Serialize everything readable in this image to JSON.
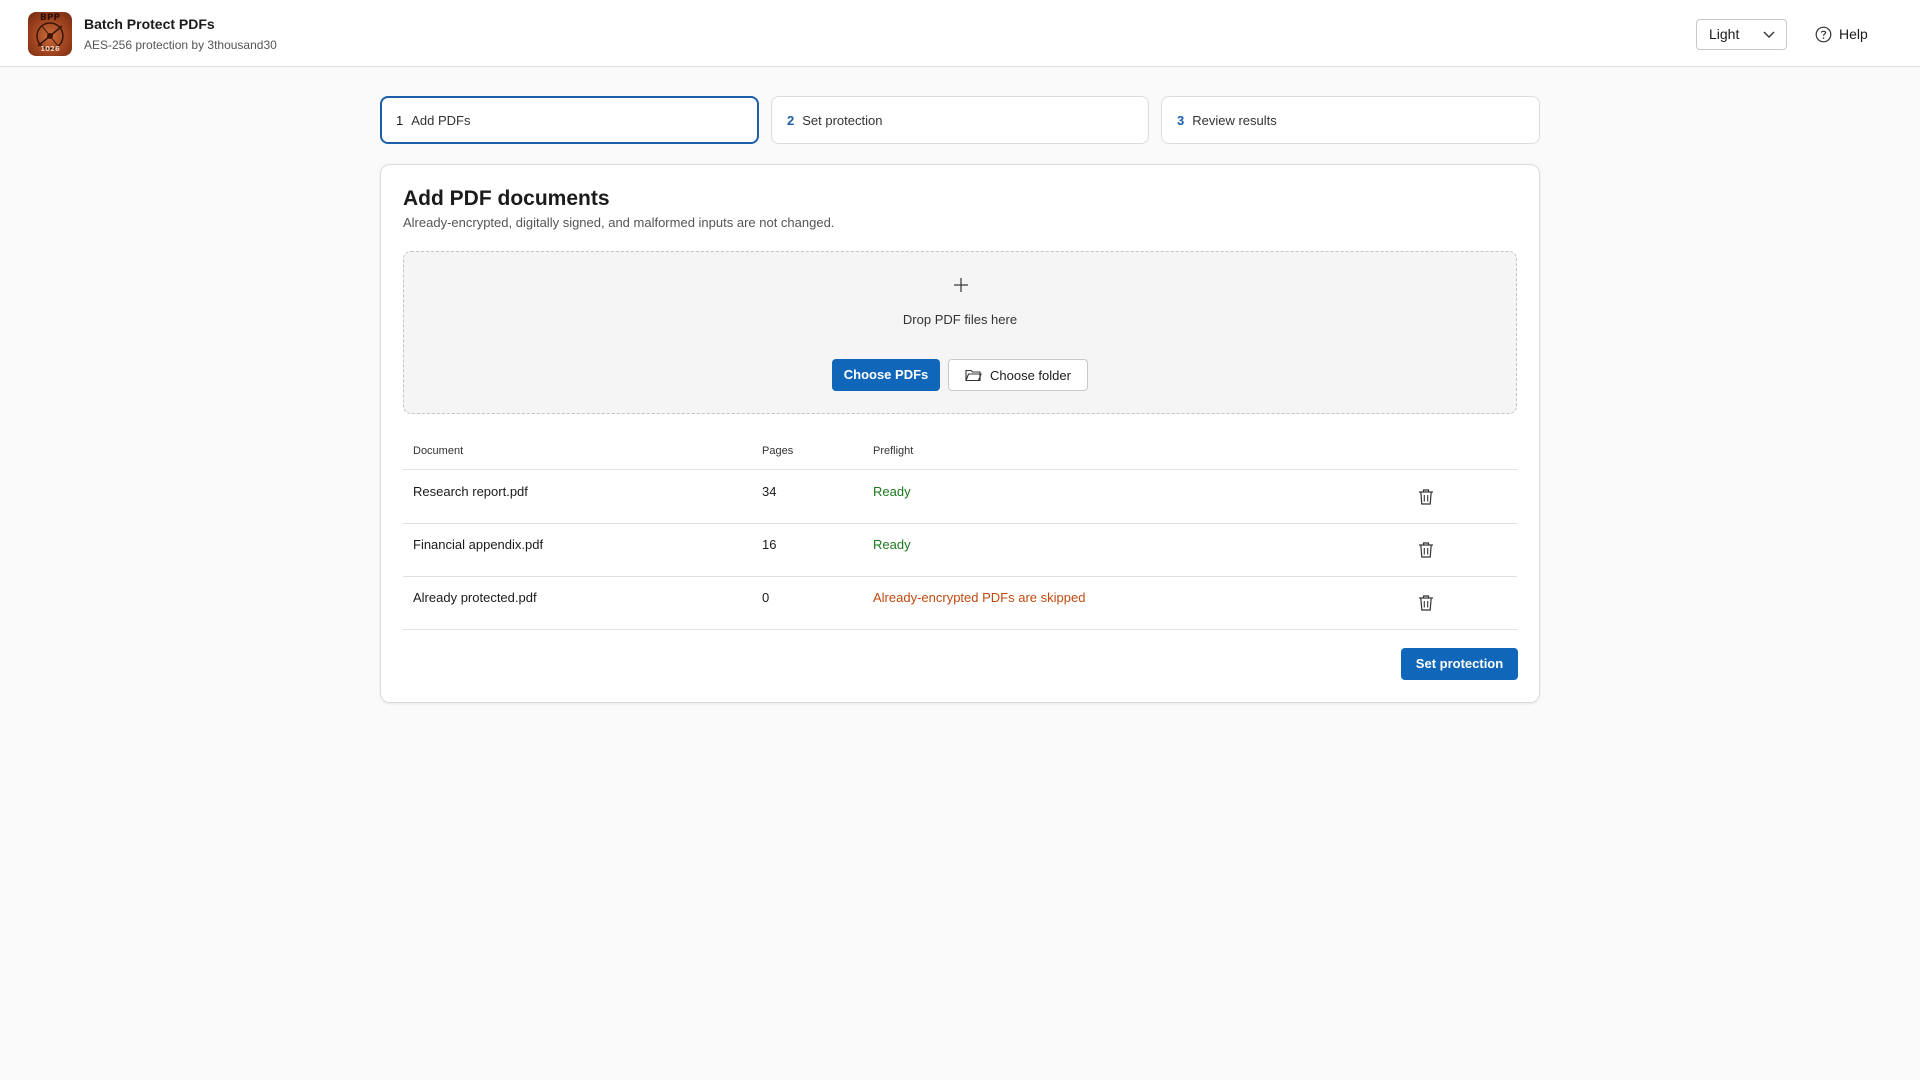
{
  "app": {
    "title": "Batch Protect PDFs",
    "subtitle": "AES-256 protection by 3thousand30",
    "logo_text_top": "BPP",
    "logo_text_bottom": "1026"
  },
  "header": {
    "theme_value": "Light",
    "help_label": "Help"
  },
  "steps": [
    {
      "num": "1",
      "label": "Add PDFs",
      "active": true
    },
    {
      "num": "2",
      "label": "Set protection",
      "active": false
    },
    {
      "num": "3",
      "label": "Review results",
      "active": false
    }
  ],
  "card": {
    "title": "Add PDF documents",
    "description": "Already-encrypted, digitally signed, and malformed inputs are not changed.",
    "dropzone_text": "Drop PDF files here",
    "choose_pdfs_label": "Choose PDFs",
    "choose_folder_label": "Choose folder"
  },
  "table": {
    "headers": {
      "document": "Document",
      "pages": "Pages",
      "preflight": "Preflight"
    },
    "rows": [
      {
        "document": "Research report.pdf",
        "pages": "34",
        "preflight": "Ready",
        "status": "ok"
      },
      {
        "document": "Financial appendix.pdf",
        "pages": "16",
        "preflight": "Ready",
        "status": "ok"
      },
      {
        "document": "Already protected.pdf",
        "pages": "0",
        "preflight": "Already-encrypted PDFs are skipped",
        "status": "warn"
      }
    ]
  },
  "footer": {
    "next_label": "Set protection"
  },
  "colors": {
    "accent": "#1066b8",
    "ready": "#1c7a1f",
    "skipped": "#c24a0f"
  },
  "icons": {
    "help": "question-circle-icon",
    "theme_dropdown": "chevron-down-icon",
    "dropzone": "plus-icon",
    "folder": "folder-icon",
    "row_action": "trash-icon"
  }
}
